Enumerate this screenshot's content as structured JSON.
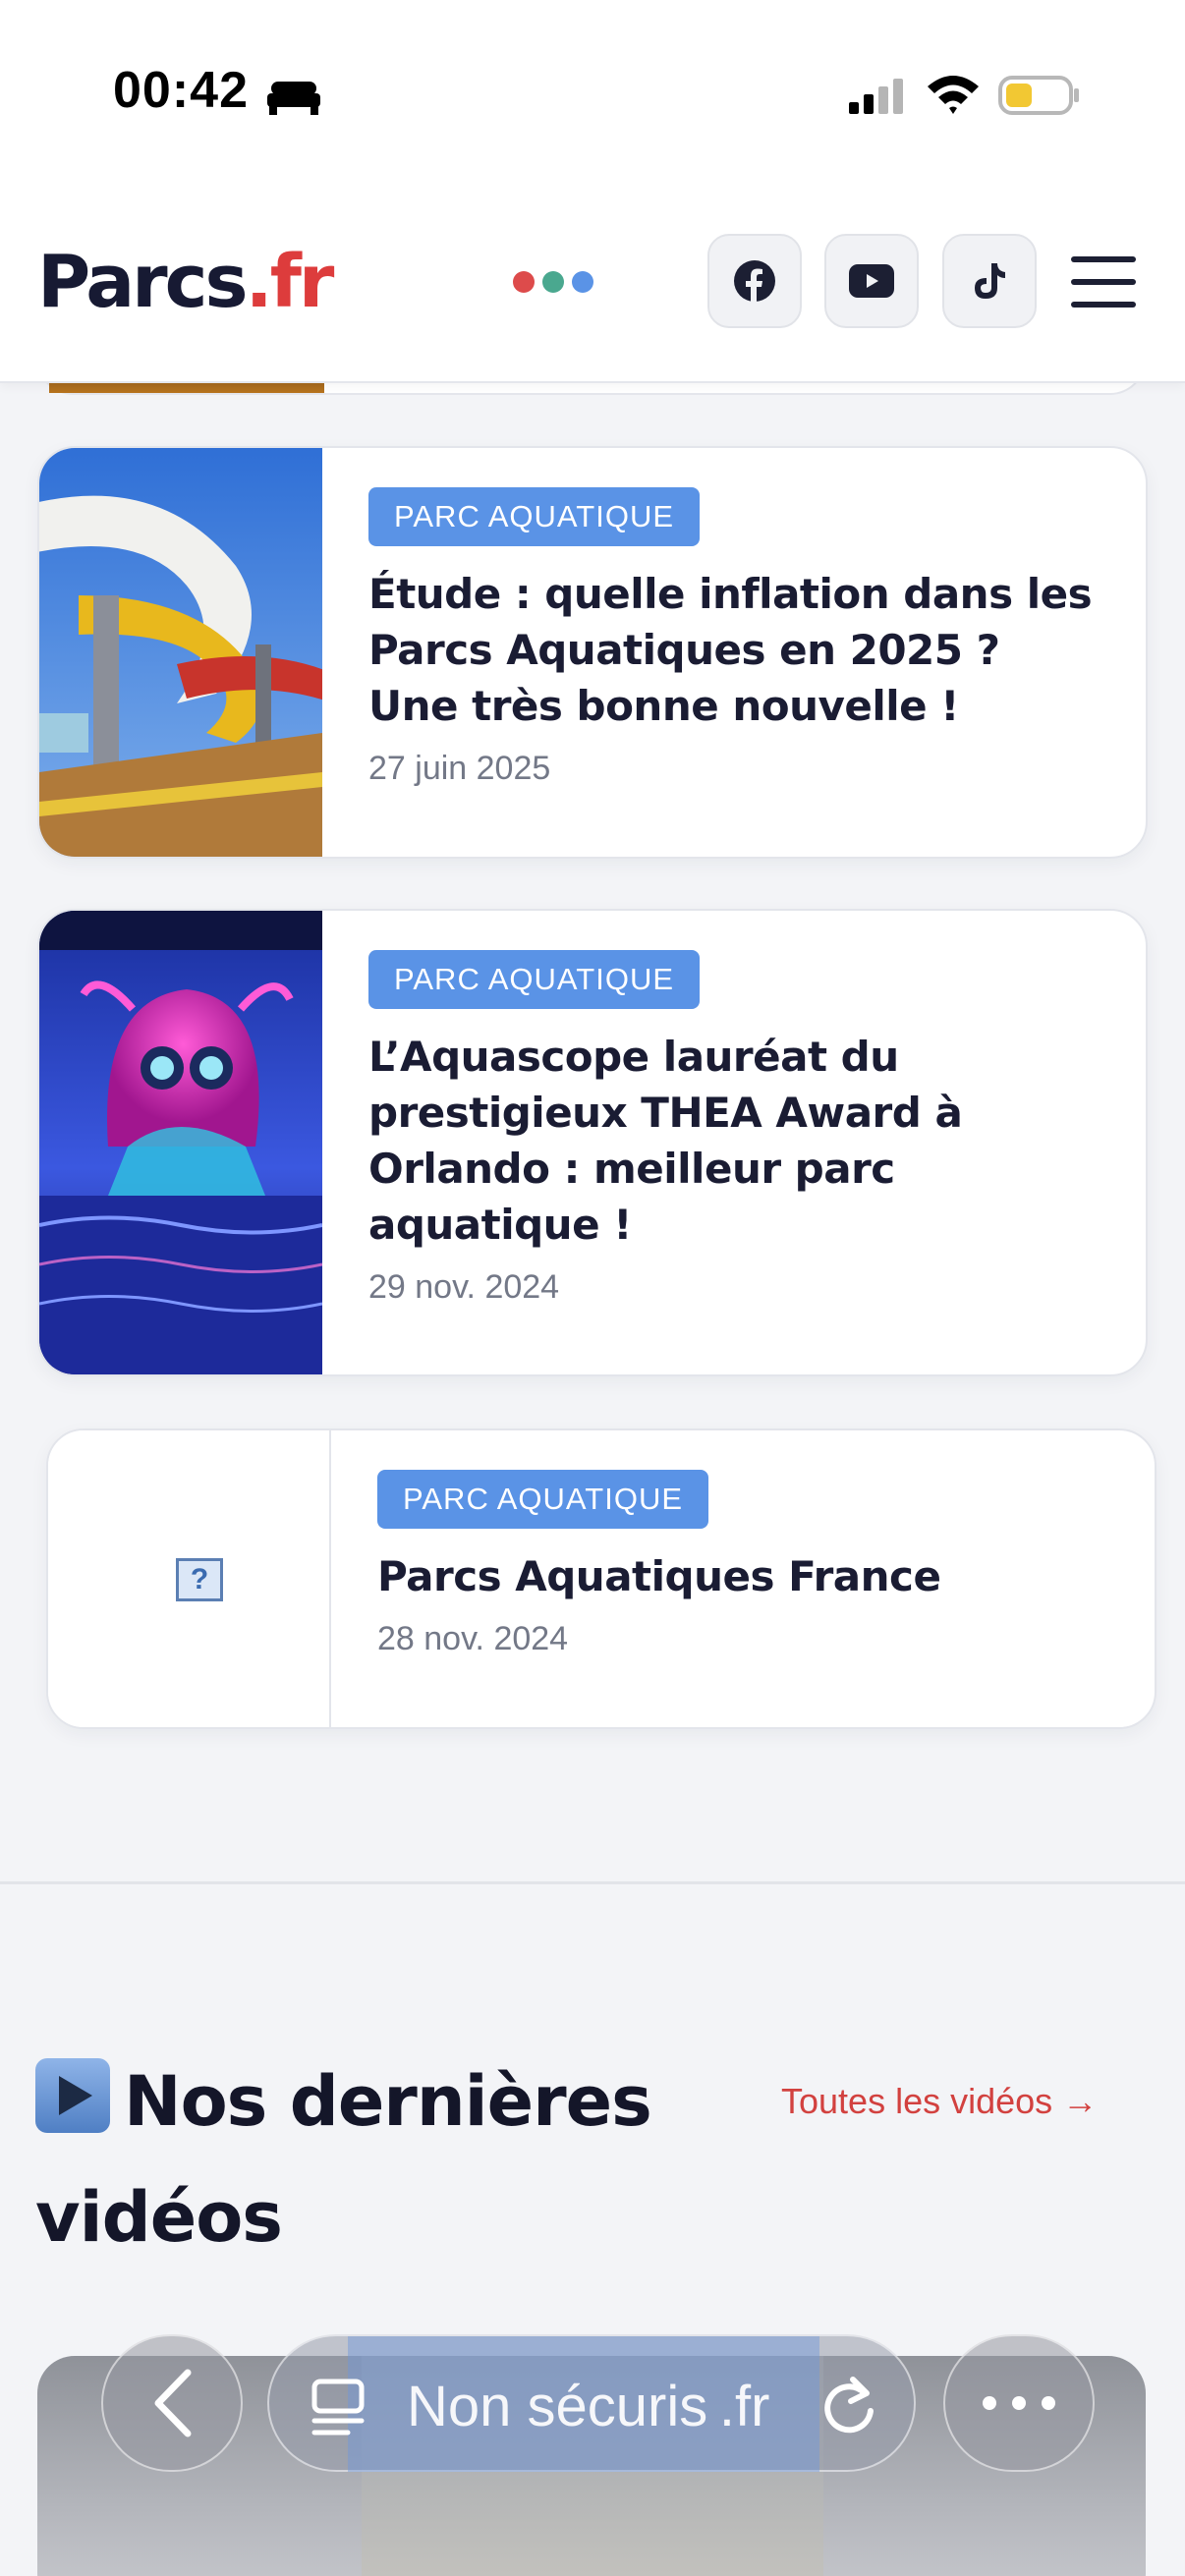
{
  "status_bar": {
    "time": "00:42"
  },
  "header": {
    "logo_main": "Parcs",
    "logo_tld": ".fr",
    "logo_dot_colors": [
      "#dd4b4b",
      "#4aa88f",
      "#5a93e6"
    ],
    "social": [
      "facebook-icon",
      "youtube-icon",
      "tiktok-icon"
    ]
  },
  "articles": [
    {
      "category": "PARC AQUATIQUE",
      "title": "Étude : quelle inflation dans les Parcs Aquatiques en 2025 ? Une très bonne nouvelle !",
      "date": "27 juin 2025"
    },
    {
      "category": "PARC AQUATIQUE",
      "title": "L’Aquascope lauréat du prestigieux THEA Award à Orlando : meilleur parc aquatique !",
      "date": "29 nov. 2024"
    },
    {
      "category": "PARC AQUATIQUE",
      "title": "Parcs Aquatiques France",
      "date": "28 nov. 2024"
    }
  ],
  "videos_section": {
    "heading": "Nos dernières vidéos",
    "all_link": "Toutes les vidéos →"
  },
  "browser": {
    "address": "Non sécuris .fr"
  },
  "colors": {
    "accent_red": "#d2413f",
    "badge_blue": "#5a93e6"
  }
}
